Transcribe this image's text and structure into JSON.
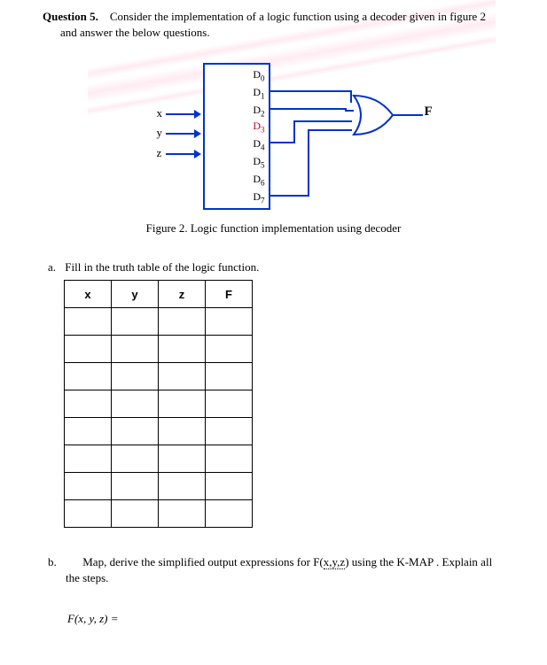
{
  "question": {
    "number_label": "Question 5.",
    "prompt_line1": "Consider the implementation of a logic function using a decoder given in figure 2",
    "prompt_line2": "and answer the below questions."
  },
  "figure": {
    "inputs": {
      "x": "x",
      "y": "y",
      "z": "z"
    },
    "outputs": [
      "D0",
      "D1",
      "D2",
      "D3",
      "D4",
      "D5",
      "D6",
      "D7"
    ],
    "out_sub": [
      "0",
      "1",
      "2",
      "3",
      "4",
      "5",
      "6",
      "7"
    ],
    "output_label": "F",
    "caption": "Figure 2. Logic function implementation using decoder"
  },
  "part_a": {
    "letter": "a.",
    "text": "Fill in the truth table of the logic function.",
    "headers": {
      "x": "x",
      "y": "y",
      "z": "z",
      "f": "F"
    },
    "rows": 8
  },
  "part_b": {
    "letter": "b.",
    "text_main": "Map, derive the simplified output expressions for F(",
    "vars": "x,y,z",
    "text_tail": ") using the K-MAP . Explain all",
    "text_line2": "the steps."
  },
  "fx": {
    "lhs": "F(x, y, z) ="
  },
  "chart_data": {
    "type": "table",
    "figure_type": "decoder + OR gate",
    "decoder_inputs": [
      "x",
      "y",
      "z"
    ],
    "decoder_outputs_connected_to_OR": [
      "D1",
      "D2",
      "D4",
      "D7"
    ],
    "gate": "OR",
    "output_name": "F",
    "implied_minterms": [
      1,
      2,
      4,
      7
    ],
    "truth_table_headers": [
      "x",
      "y",
      "z",
      "F"
    ],
    "truth_table_rows_blank": 8
  }
}
